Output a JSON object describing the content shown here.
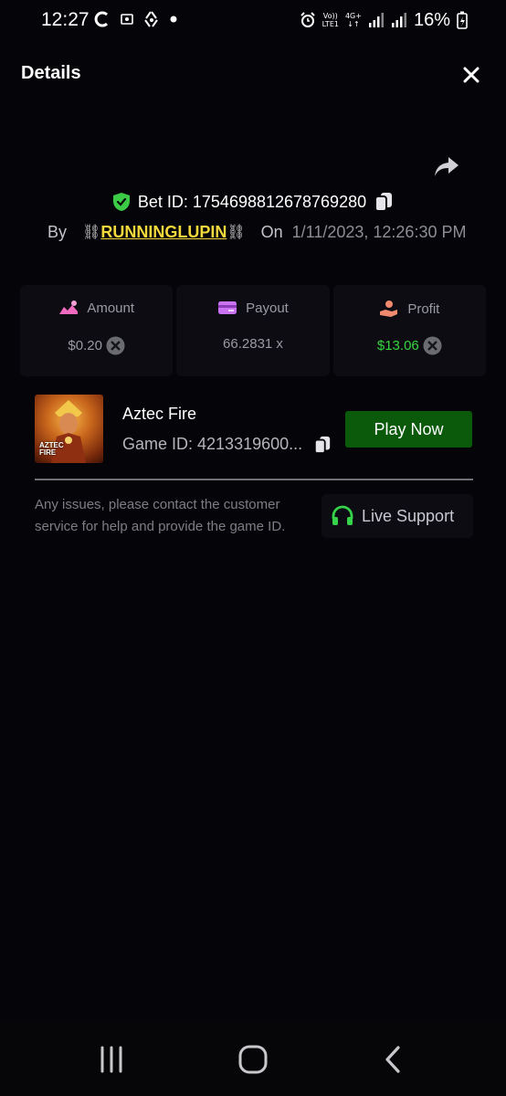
{
  "status_bar": {
    "time": "12:27",
    "left_icons": [
      "sync-icon",
      "gallery-icon",
      "recycle-icon",
      "dot-icon"
    ],
    "network_top": "Vo))",
    "network_bottom": "LTE1",
    "network_gen": "4G+",
    "battery": "16%"
  },
  "header": {
    "title": "Details"
  },
  "bet": {
    "id_label": "Bet ID: 1754698812678769280",
    "by_label": "By",
    "chain_left": "⛓",
    "username": "RUNNINGLUPIN",
    "chain_right": "⛓",
    "on_label": "On",
    "date": "1/11/2023, 12:26:30 PM"
  },
  "stats": {
    "amount": {
      "label": "Amount",
      "value": "$0.20"
    },
    "payout": {
      "label": "Payout",
      "value": "66.2831 x"
    },
    "profit": {
      "label": "Profit",
      "value": "$13.06"
    }
  },
  "game": {
    "thumb_line1": "AZTEC",
    "thumb_line2": "FIRE",
    "name": "Aztec Fire",
    "id_label": "Game ID: 4213319600...",
    "play_label": "Play Now"
  },
  "support": {
    "text": "Any issues, please contact the customer service for help and provide the game ID.",
    "button_label": "Live Support"
  },
  "colors": {
    "accent_green": "#0b5a0c",
    "profit_green": "#37d63f",
    "username_yellow": "#f4d93c"
  }
}
